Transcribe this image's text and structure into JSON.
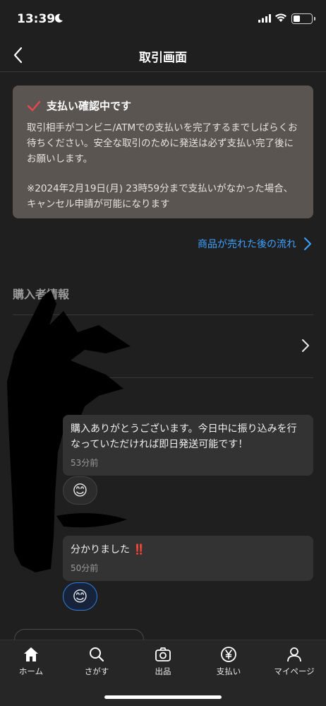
{
  "status_bar": {
    "time": "13:39",
    "icons": [
      "moon-icon",
      "signal-icon",
      "wifi-icon",
      "battery-icon"
    ]
  },
  "header": {
    "title": "取引画面",
    "back_icon": "chevron-left-icon"
  },
  "notice": {
    "icon": "check-icon",
    "accent_color": "#e5484d",
    "title": "支払い確認中です",
    "body": "取引相手がコンビニ/ATMでの支払いを完了するまでしばらくお待ちください。安全な取引のために発送は必ず支払い完了後にお願いします。",
    "note": "※2024年2月19日(月) 23時59分まで支払いがなかった場合、キャンセル申請が可能になります"
  },
  "flow_link": {
    "label": "商品が売れた後の流れ",
    "color": "#3ea2ff"
  },
  "buyer_section": {
    "title": "購入者情報"
  },
  "messages": [
    {
      "text": "購入ありがとうございます。今日中に振り込みを行なっていただければ即日発送可能です！",
      "time": "53分前",
      "reaction": "😊"
    },
    {
      "text": "分かりました",
      "emphasis": "‼️",
      "time": "50分前",
      "reaction": "😊"
    }
  ],
  "tabs": [
    {
      "label": "ホーム",
      "icon": "home-icon"
    },
    {
      "label": "さがす",
      "icon": "search-icon"
    },
    {
      "label": "出品",
      "icon": "camera-icon"
    },
    {
      "label": "支払い",
      "icon": "yen-icon"
    },
    {
      "label": "マイページ",
      "icon": "person-icon"
    }
  ]
}
